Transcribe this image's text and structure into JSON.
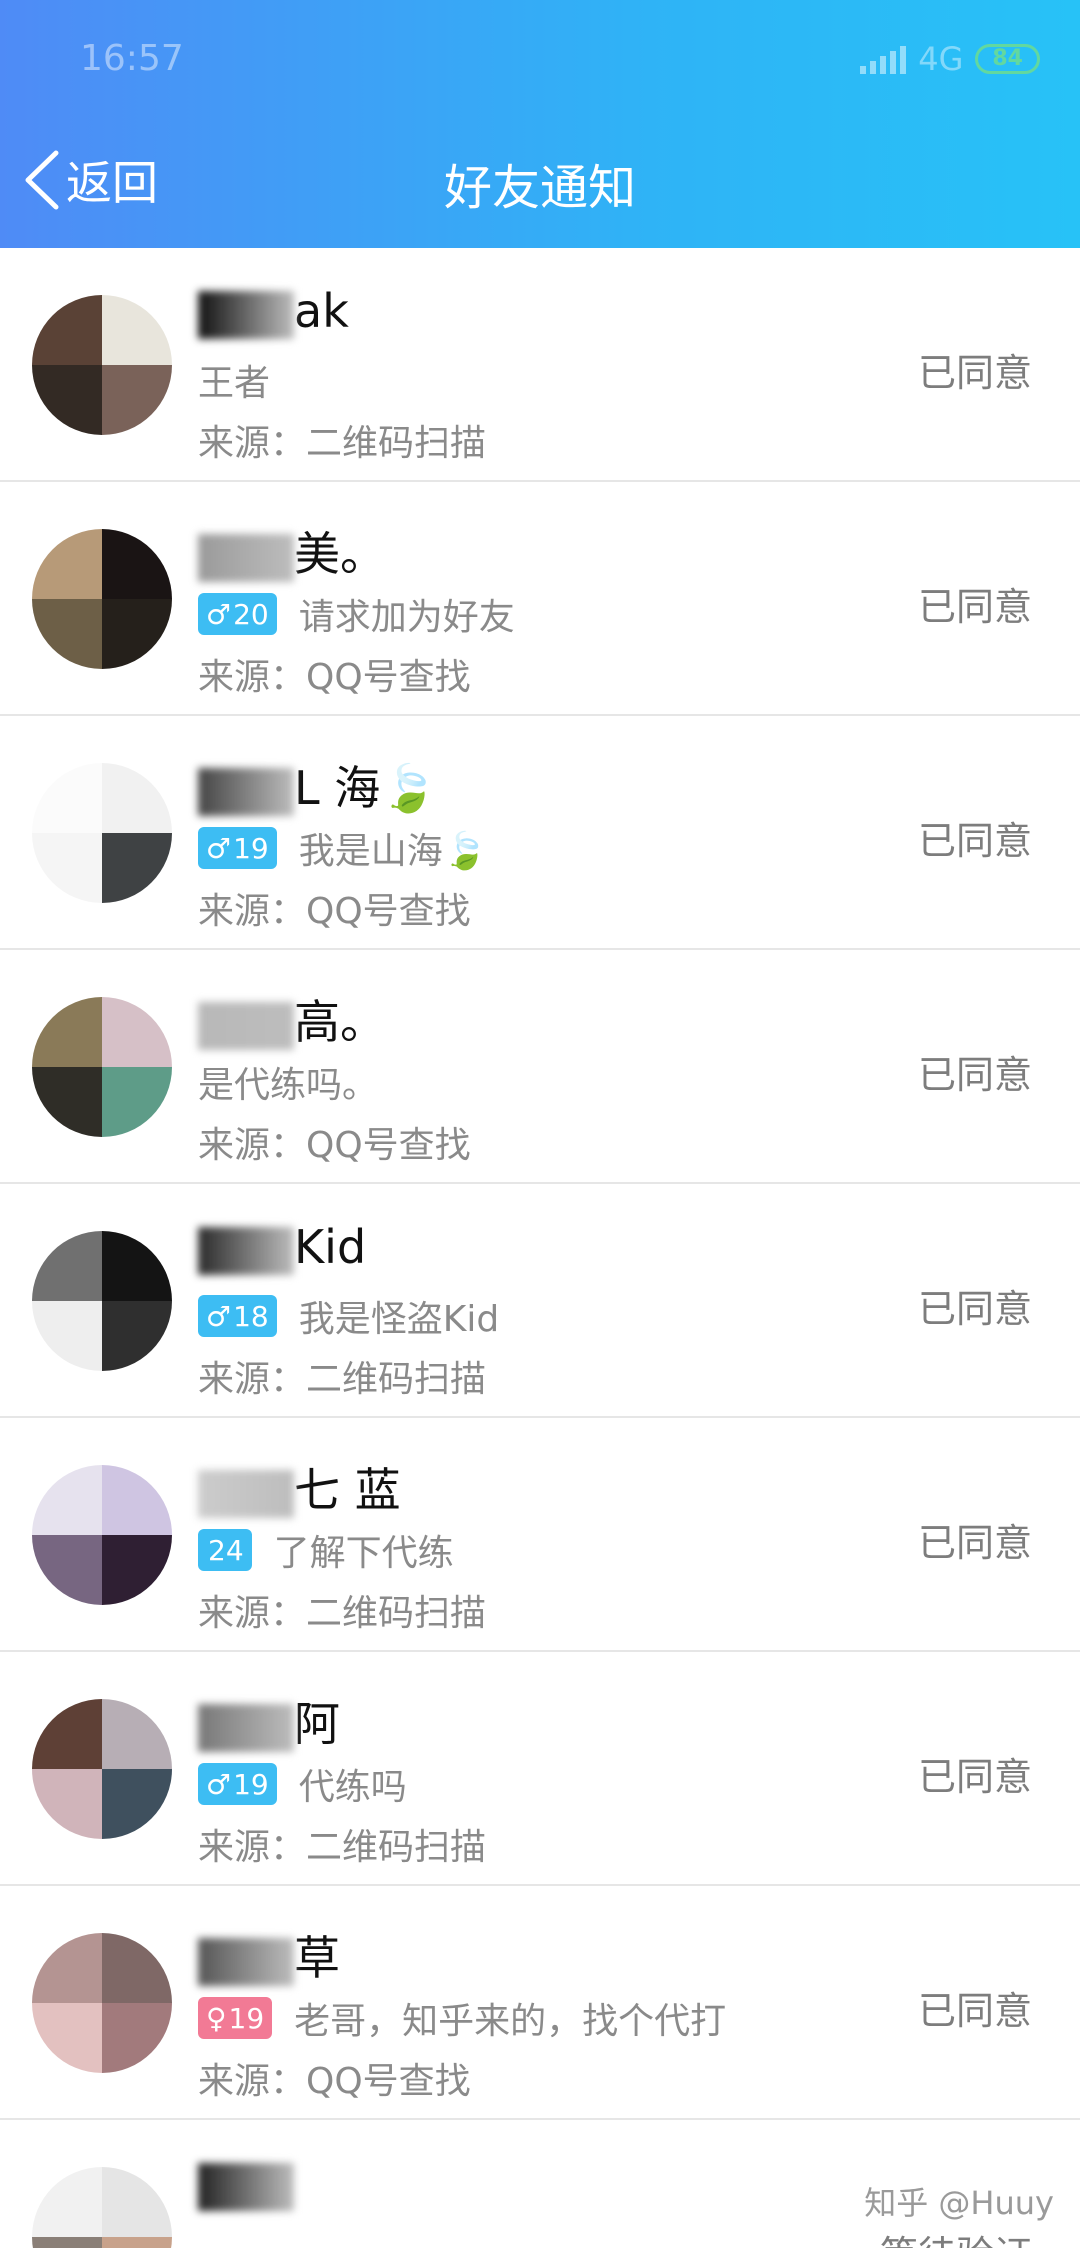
{
  "status_bar": {
    "time": "16:57",
    "network": "4G",
    "battery": "84"
  },
  "header": {
    "back_label": "返回",
    "title": "好友通知"
  },
  "requests": [
    {
      "name_visible": "ak",
      "badge": null,
      "message": "王者",
      "source": "来源：二维码扫描",
      "status": "已同意",
      "avatar_colors": [
        "#5a4236",
        "#e8e5dc",
        "#332a24",
        "#7a6259"
      ]
    },
    {
      "name_visible": "美。",
      "badge": {
        "gender": "male",
        "icon": "♂",
        "age": "20"
      },
      "message": "请求加为好友",
      "source": "来源：QQ号查找",
      "status": "已同意",
      "avatar_colors": [
        "#b79a78",
        "#1a1414",
        "#6d5f47",
        "#25201b"
      ]
    },
    {
      "name_visible": "L 海🍃",
      "badge": {
        "gender": "male",
        "icon": "♂",
        "age": "19"
      },
      "message": "我是山海🍃",
      "source": "来源：QQ号查找",
      "status": "已同意",
      "avatar_colors": [
        "#fbfbfb",
        "#f1f1f1",
        "#f5f5f5",
        "#3f4244"
      ]
    },
    {
      "name_visible": "高。",
      "badge": null,
      "message": "是代练吗。",
      "source": "来源：QQ号查找",
      "status": "已同意",
      "avatar_colors": [
        "#8a7a58",
        "#d6c0c7",
        "#2f2d27",
        "#5e9c88"
      ]
    },
    {
      "name_visible": "Kid",
      "badge": {
        "gender": "male",
        "icon": "♂",
        "age": "18"
      },
      "message": "我是怪盗Kid",
      "source": "来源：二维码扫描",
      "status": "已同意",
      "avatar_colors": [
        "#707070",
        "#141414",
        "#eeeeee",
        "#2f2f2f"
      ]
    },
    {
      "name_visible": "七 蓝",
      "badge": {
        "gender": "none",
        "icon": "",
        "age": "24"
      },
      "message": "了解下代练",
      "source": "来源：二维码扫描",
      "status": "已同意",
      "avatar_colors": [
        "#e6e2ee",
        "#cfc5e2",
        "#776681",
        "#2f1f33"
      ]
    },
    {
      "name_visible": "阿",
      "badge": {
        "gender": "male",
        "icon": "♂",
        "age": "19"
      },
      "message": "代练吗",
      "source": "来源：二维码扫描",
      "status": "已同意",
      "avatar_colors": [
        "#5e4036",
        "#b7aeb5",
        "#d0b4ba",
        "#3f505e"
      ]
    },
    {
      "name_visible": "草",
      "badge": {
        "gender": "female",
        "icon": "♀",
        "age": "19"
      },
      "message": "老哥，知乎来的，找个代打",
      "source": "来源：QQ号查找",
      "status": "已同意",
      "avatar_colors": [
        "#b49492",
        "#7f6866",
        "#e3c1c0",
        "#a27a7c"
      ]
    },
    {
      "name_visible": "",
      "badge": null,
      "message": "",
      "source": "",
      "status": "等待验证",
      "avatar_colors": [
        "#f1f1f1",
        "#e5e5e5",
        "#8a7f77",
        "#c8a28b"
      ]
    }
  ],
  "watermark": "知乎 @Huuy"
}
